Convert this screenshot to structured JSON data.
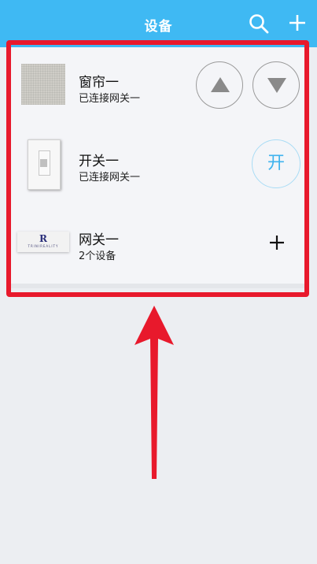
{
  "header": {
    "title": "设备",
    "background_color": "#3fb9f3"
  },
  "devices": [
    {
      "name": "窗帘一",
      "status": "已连接网关一",
      "icon": "curtain-panel-thumbnail",
      "controls": [
        "up-arrow-button",
        "down-arrow-button"
      ]
    },
    {
      "name": "开关一",
      "status": "已连接网关一",
      "icon": "wall-switch-thumbnail",
      "toggle_label": "开"
    },
    {
      "name": "网关一",
      "status": "2个设备",
      "icon": "gateway-thumbnail",
      "logo_text": "TRINIREALITY"
    }
  ],
  "annotation": {
    "highlight_color": "#e8192c"
  }
}
